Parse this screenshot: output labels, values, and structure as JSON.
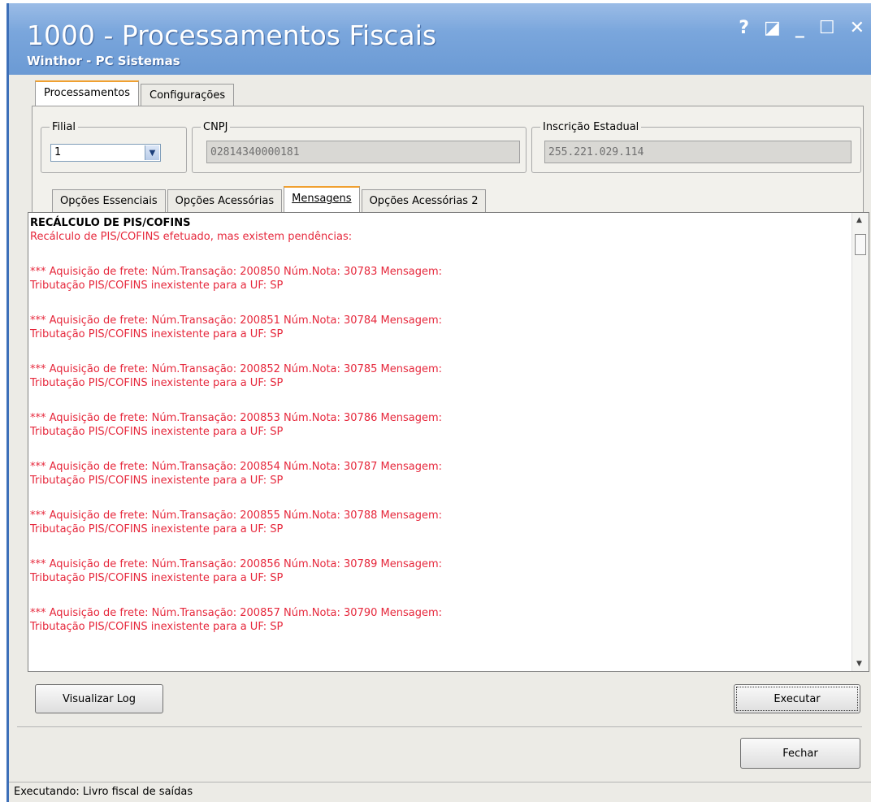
{
  "window": {
    "title": "1000 - Processamentos Fiscais",
    "subtitle": "Winthor - PC Sistemas",
    "buttons": {
      "help": "?",
      "restore_small": "◪",
      "minimize": "_",
      "maximize": "☐",
      "close": "✕"
    }
  },
  "main_tabs": [
    {
      "label": "Processamentos",
      "active": true
    },
    {
      "label": "Configurações",
      "active": false
    }
  ],
  "filial": {
    "legend": "Filial",
    "value": "1"
  },
  "cnpj": {
    "legend": "CNPJ",
    "value": "02814340000181"
  },
  "ie": {
    "legend": "Inscrição Estadual",
    "value": "255.221.029.114"
  },
  "sub_tabs": [
    {
      "label": "Opções Essenciais",
      "active": false
    },
    {
      "label": "Opções Acessórias",
      "active": false
    },
    {
      "label": "Mensagens",
      "active": true
    },
    {
      "label": "Opções Acessórias 2",
      "active": false
    }
  ],
  "messages": {
    "title": "RECÁLCULO DE PIS/COFINS",
    "summary": "Recálculo de PIS/COFINS efetuado, mas existem pendências:",
    "entries": [
      {
        "line1": "*** Aquisição de frete: Núm.Transação: 200850 Núm.Nota: 30783 Mensagem:",
        "line2": "Tributação PIS/COFINS inexistente para a UF: SP"
      },
      {
        "line1": "*** Aquisição de frete: Núm.Transação: 200851 Núm.Nota: 30784 Mensagem:",
        "line2": "Tributação PIS/COFINS inexistente para a UF: SP"
      },
      {
        "line1": "*** Aquisição de frete: Núm.Transação: 200852 Núm.Nota: 30785 Mensagem:",
        "line2": "Tributação PIS/COFINS inexistente para a UF: SP"
      },
      {
        "line1": "*** Aquisição de frete: Núm.Transação: 200853 Núm.Nota: 30786 Mensagem:",
        "line2": "Tributação PIS/COFINS inexistente para a UF: SP"
      },
      {
        "line1": "*** Aquisição de frete: Núm.Transação: 200854 Núm.Nota: 30787 Mensagem:",
        "line2": "Tributação PIS/COFINS inexistente para a UF: SP"
      },
      {
        "line1": "*** Aquisição de frete: Núm.Transação: 200855 Núm.Nota: 30788 Mensagem:",
        "line2": "Tributação PIS/COFINS inexistente para a UF: SP"
      },
      {
        "line1": "*** Aquisição de frete: Núm.Transação: 200856 Núm.Nota: 30789 Mensagem:",
        "line2": "Tributação PIS/COFINS inexistente para a UF: SP"
      },
      {
        "line1": "*** Aquisição de frete: Núm.Transação: 200857 Núm.Nota: 30790 Mensagem:",
        "line2": "Tributação PIS/COFINS inexistente para a UF: SP"
      }
    ]
  },
  "buttons": {
    "visualizar_log": "Visualizar Log",
    "executar": "Executar",
    "fechar": "Fechar"
  },
  "status": "Executando: Livro fiscal de saídas",
  "colors": {
    "title_bar": "#7aa6dc",
    "error_text": "#e6283c",
    "active_tab_accent": "#f0a030"
  }
}
